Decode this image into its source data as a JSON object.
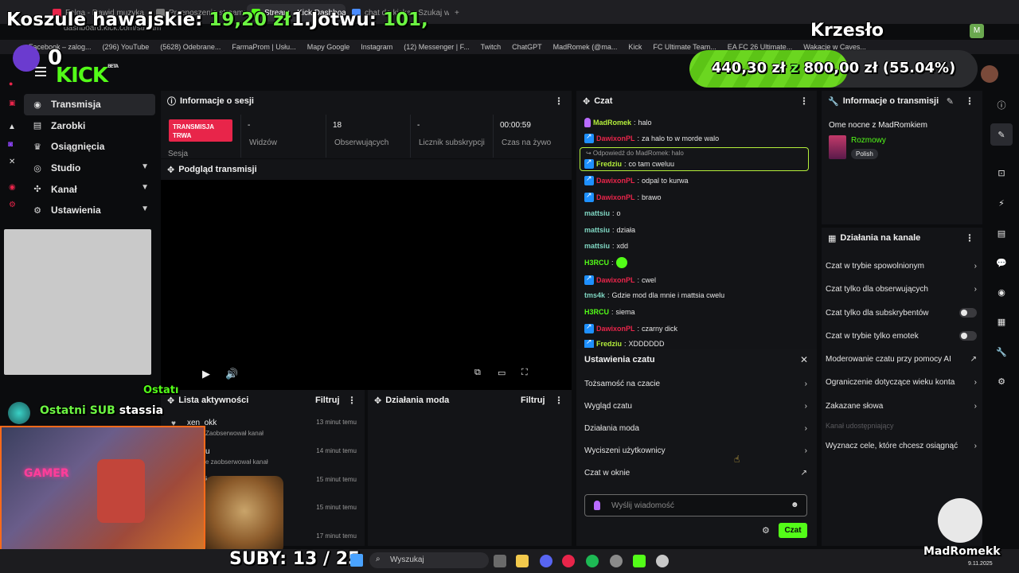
{
  "browser": {
    "tabs": [
      {
        "label": "Felga - Dawid muzyka"
      },
      {
        "label": "Przenoszenie streama n"
      },
      {
        "label": "Stream - Kick Dashboard"
      },
      {
        "label": "chat do kicka - Szukaj w"
      }
    ],
    "url": "dashboard.kick.com/stream",
    "bookmarks": [
      "Facebook – zalog...",
      "(296) YouTube",
      "(5628) Odebrane...",
      "FarmaProm | Usłu...",
      "Mapy Google",
      "Instagram",
      "(12) Messenger | F...",
      "Twitch",
      "ChatGPT",
      "MadRomek (@ma...",
      "Kick",
      "FC Ultimate Team...",
      "EA FC 26 Ultimate...",
      "Wakacje w Caves..."
    ],
    "profile_initial": "M"
  },
  "overlay": {
    "koszule_label": "Koszule hawajskie:",
    "koszule_value": "19,20 zł",
    "jotwu_label": "1.Jotwu:",
    "jotwu_value": "101,",
    "krzeslo": "Krzesło",
    "counter": "0",
    "goal_current": "440,30 zł",
    "goal_z": "z",
    "goal_target": "800,00 zł",
    "goal_percent": "(55.04%)",
    "goal_fraction": 0.5504,
    "last_sub_label": "Ostatni SUB",
    "last_sub_name": "stassia",
    "ostatni_small": "Ostatı",
    "subs_text": "SUBY: 13 / 25",
    "tiktok_name": "MadRomekk",
    "cam_text": "GAMER"
  },
  "sidebar": {
    "items": [
      {
        "label": "Transmisja"
      },
      {
        "label": "Zarobki"
      },
      {
        "label": "Osiągnięcia"
      },
      {
        "label": "Studio"
      },
      {
        "label": "Kanał"
      },
      {
        "label": "Ustawienia"
      }
    ]
  },
  "session": {
    "title": "Informacje o sesji",
    "badge": "TRANSMISJA TRWA",
    "badge_sub": "Sesja",
    "stats": [
      {
        "value": "-",
        "label": "Widzów"
      },
      {
        "value": "18",
        "label": "Obserwujących"
      },
      {
        "value": "-",
        "label": "Licznik subskrypcji"
      },
      {
        "value": "00:00:59",
        "label": "Czas na żywo"
      }
    ]
  },
  "preview": {
    "title": "Podgląd transmisji"
  },
  "activity": {
    "title": "Lista aktywności",
    "filter": "Filtruj",
    "rows": [
      {
        "name": "xen_okk",
        "desc": "Zaobserwował kanał",
        "time": "13 minut temu"
      },
      {
        "name": "u",
        "desc": "e zaobserwował kanał",
        "time": "14 minut temu"
      },
      {
        "name": "iu",
        "desc": "",
        "time": "15 minut temu"
      },
      {
        "name": "",
        "desc": "",
        "time": "15 minut temu"
      },
      {
        "name": "",
        "desc": "",
        "time": "17 minut temu"
      }
    ]
  },
  "mod": {
    "title": "Działania moda",
    "filter": "Filtruj"
  },
  "chat": {
    "title": "Czat",
    "reply_label": "↪ Odpowiedź do MadRomek: halo",
    "messages": [
      {
        "user": "MadRomek",
        "text": "halo",
        "color": "#b4ef3b"
      },
      {
        "user": "DawixonPL",
        "text": "za halo to w morde walo",
        "color": "#e8254a"
      },
      {
        "user": "Fredziu",
        "text": "co tam cweluu",
        "color": "#b4ef3b"
      },
      {
        "user": "DawixonPL",
        "text": "odpal to kurwa",
        "color": "#e8254a"
      },
      {
        "user": "DawixonPL",
        "text": "brawo",
        "color": "#e8254a"
      },
      {
        "user": "mattsiu",
        "text": "o",
        "color": "#7fd6c2"
      },
      {
        "user": "mattsiu",
        "text": "działa",
        "color": "#7fd6c2"
      },
      {
        "user": "mattsiu",
        "text": "xdd",
        "color": "#7fd6c2"
      },
      {
        "user": "H3RCU",
        "text": "",
        "color": "#53fc18"
      },
      {
        "user": "DawixonPL",
        "text": "cwel",
        "color": "#e8254a"
      },
      {
        "user": "tms4k",
        "text": "Gdzie mod dla mnie i mattsia cwelu",
        "color": "#7fd6c2"
      },
      {
        "user": "H3RCU",
        "text": "siema",
        "color": "#53fc18"
      },
      {
        "user": "DawixonPL",
        "text": "czarny dick",
        "color": "#e8254a"
      },
      {
        "user": "Fredziu",
        "text": "XDDDDDD",
        "color": "#b4ef3b"
      }
    ],
    "settings": {
      "title": "Ustawienia czatu",
      "rows": [
        "Tożsamość na czacie",
        "Wygląd czatu",
        "Działania moda",
        "Wyciszeni użytkownicy",
        "Czat w oknie"
      ]
    },
    "input_placeholder": "Wyślij wiadomość",
    "send_label": "Czat"
  },
  "stream_info": {
    "title": "Informacje o transmisji",
    "stream_title": "Ome nocne z MadRomkiem",
    "category": "Rozmowy",
    "language": "Polish"
  },
  "channel_actions": {
    "title": "Działania na kanale",
    "rows": [
      {
        "label": "Czat w trybie spowolnionym",
        "kind": "arrow"
      },
      {
        "label": "Czat tylko dla obserwujących",
        "kind": "arrow"
      },
      {
        "label": "Czat tylko dla subskrybentów",
        "kind": "toggle"
      },
      {
        "label": "Czat w trybie tylko emotek",
        "kind": "toggle"
      },
      {
        "label": "Moderowanie czatu przy pomocy AI",
        "kind": "external"
      },
      {
        "label": "Ograniczenie dotyczące wieku konta",
        "kind": "arrow"
      },
      {
        "label": "Zakazane słowa",
        "kind": "arrow"
      },
      {
        "label": "Kanał udostępniający",
        "kind": "disabled"
      },
      {
        "label": "Wyznacz cele, które chcesz osiągnąć",
        "kind": "arrow"
      }
    ]
  },
  "taskbar": {
    "search": "Wyszukaj",
    "date": "9.11.2025"
  },
  "colors": {
    "kick_green": "#53fc18",
    "live_red": "#e8254a",
    "panel": "#131417",
    "bg": "#0b0c0e"
  }
}
